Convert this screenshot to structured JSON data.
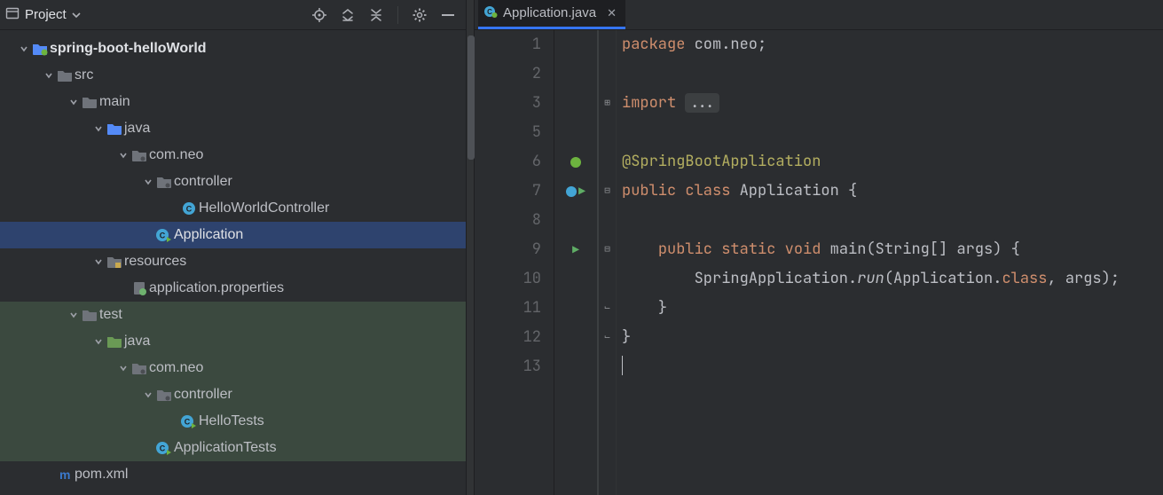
{
  "sidebar": {
    "title": "Project",
    "nodes": [
      {
        "depth": 0,
        "arrow": "down",
        "icon": "folder-open",
        "label": "spring-boot-helloWorld",
        "bold": true
      },
      {
        "depth": 1,
        "arrow": "down",
        "icon": "folder",
        "label": "src"
      },
      {
        "depth": 2,
        "arrow": "down",
        "icon": "folder",
        "label": "main"
      },
      {
        "depth": 3,
        "arrow": "down",
        "icon": "folder-blue",
        "label": "java"
      },
      {
        "depth": 4,
        "arrow": "down",
        "icon": "package",
        "label": "com.neo"
      },
      {
        "depth": 5,
        "arrow": "down",
        "icon": "package",
        "label": "controller"
      },
      {
        "depth": 6,
        "arrow": "none",
        "icon": "class",
        "label": "HelloWorldController"
      },
      {
        "depth": 5,
        "arrow": "none",
        "icon": "class-run",
        "label": "Application",
        "selected": true
      },
      {
        "depth": 3,
        "arrow": "down",
        "icon": "resources",
        "label": "resources"
      },
      {
        "depth": 4,
        "arrow": "none",
        "icon": "props",
        "label": "application.properties"
      },
      {
        "depth": 2,
        "arrow": "down",
        "icon": "folder",
        "label": "test",
        "shade": "test"
      },
      {
        "depth": 3,
        "arrow": "down",
        "icon": "folder-green",
        "label": "java",
        "shade": "test"
      },
      {
        "depth": 4,
        "arrow": "down",
        "icon": "package",
        "label": "com.neo",
        "shade": "test"
      },
      {
        "depth": 5,
        "arrow": "down",
        "icon": "package",
        "label": "controller",
        "shade": "test"
      },
      {
        "depth": 6,
        "arrow": "none",
        "icon": "class-run",
        "label": "HelloTests",
        "shade": "test"
      },
      {
        "depth": 5,
        "arrow": "none",
        "icon": "class-run",
        "label": "ApplicationTests",
        "shade": "test"
      },
      {
        "depth": 1,
        "arrow": "none",
        "icon": "maven",
        "label": "pom.xml"
      }
    ]
  },
  "editor": {
    "tab": {
      "label": "Application.java"
    },
    "line_numbers": [
      "1",
      "2",
      "3",
      "5",
      "6",
      "7",
      "8",
      "9",
      "10",
      "11",
      "12",
      "13"
    ],
    "code": {
      "l1": {
        "kw": "package",
        "id": "com.neo",
        "semi": ";"
      },
      "l3": {
        "kw": "import",
        "dots": "..."
      },
      "l6": {
        "ann": "@SpringBootApplication"
      },
      "l7": {
        "kw1": "public",
        "kw2": "class",
        "typ": "Application",
        "brace": "{"
      },
      "l9": {
        "kw1": "public",
        "kw2": "static",
        "kw3": "void",
        "fn": "main",
        "sig": "(String[] args) {"
      },
      "l10": {
        "call": "SpringApplication.",
        "ital": "run",
        "args": "(Application.",
        "kw": "class",
        "rest": ", args);"
      },
      "l11": {
        "brace": "}"
      },
      "l12": {
        "brace": "}"
      }
    }
  }
}
